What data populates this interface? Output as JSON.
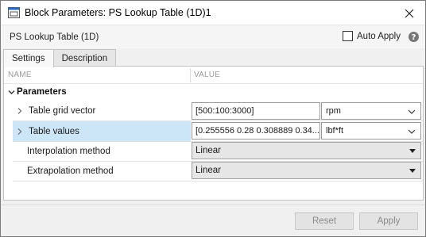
{
  "window": {
    "title": "Block Parameters: PS Lookup Table (1D)1"
  },
  "header": {
    "block_name": "PS Lookup Table (1D)",
    "auto_apply_label": "Auto Apply",
    "auto_apply_checked": false
  },
  "tabs": [
    {
      "label": "Settings",
      "active": true
    },
    {
      "label": "Description",
      "active": false
    }
  ],
  "table": {
    "col_name": "NAME",
    "col_value": "VALUE",
    "group_label": "Parameters",
    "rows": [
      {
        "label": "Table grid vector",
        "value": "[500:100:3000]",
        "unit": "rpm"
      },
      {
        "label": "Table values",
        "value": "[0.255556 0.28 0.308889 0.34...",
        "unit": "lbf*ft"
      },
      {
        "label": "Interpolation method",
        "value": "Linear"
      },
      {
        "label": "Extrapolation method",
        "value": "Linear"
      }
    ]
  },
  "footer": {
    "reset_label": "Reset",
    "apply_label": "Apply"
  },
  "colors": {
    "selected_row": "#cde6f7",
    "app_icon_blue": "#2a6cb8"
  }
}
